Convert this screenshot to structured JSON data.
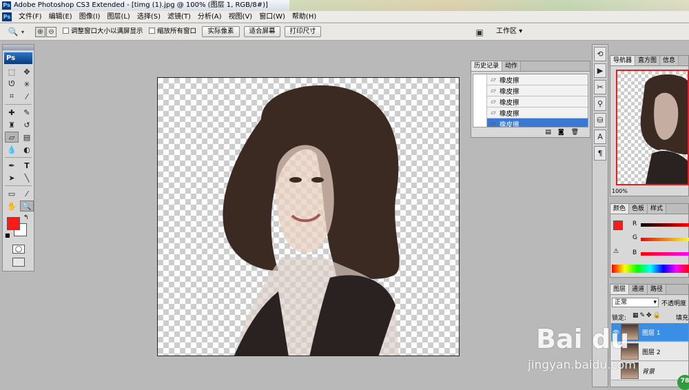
{
  "window": {
    "title": "Adobe Photoshop CS3 Extended - [timg (1).jpg @ 100% (图层 1, RGB/8#)]",
    "app_badge": "Ps"
  },
  "menu": [
    "文件(F)",
    "编辑(E)",
    "图像(I)",
    "图层(L)",
    "选择(S)",
    "滤镜(T)",
    "分析(A)",
    "视图(V)",
    "窗口(W)",
    "帮助(H)"
  ],
  "options": {
    "resize_windows": "调整窗口大小以满屏显示",
    "zoom_all": "缩放所有窗口",
    "actual_pixels": "实际像素",
    "fit_screen": "适合屏幕",
    "print_size": "打印尺寸",
    "workspace": "工作区 ▾"
  },
  "toolbox": {
    "logo": "Ps",
    "fg_color": "#ff1a1a",
    "bg_color": "#ffffff"
  },
  "history": {
    "tabs": [
      "历史记录",
      "动作"
    ],
    "items": [
      "橡皮擦",
      "橡皮擦",
      "橡皮擦",
      "橡皮擦",
      "橡皮擦"
    ],
    "active_index": 4
  },
  "navigator": {
    "tabs": [
      "导航器",
      "直方图",
      "信息"
    ],
    "zoom": "100%"
  },
  "color": {
    "tabs": [
      "颜色",
      "色板",
      "样式"
    ],
    "channels": [
      "R",
      "G",
      "B"
    ],
    "fg": "#ff1a1a"
  },
  "layers": {
    "tabs": [
      "图层",
      "通道",
      "路径"
    ],
    "blend_mode": "正常",
    "opacity_label": "不透明度",
    "lock_label": "锁定:",
    "fill_label": "填充",
    "items": [
      {
        "name": "图层 1",
        "selected": true
      },
      {
        "name": "图层 2",
        "selected": false
      },
      {
        "name": "背景",
        "selected": false
      }
    ]
  },
  "watermark": {
    "brand": "Bai du",
    "url": "jingyan.baidu.com"
  },
  "badge": "78"
}
